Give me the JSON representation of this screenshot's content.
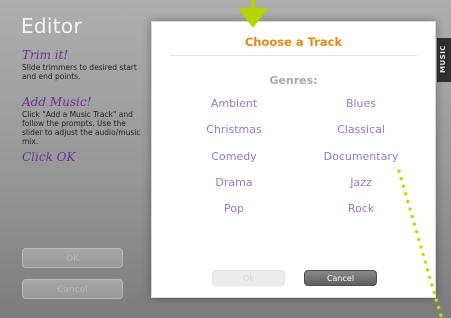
{
  "editor": {
    "title": "Editor",
    "steps": [
      {
        "title": "Trim it!",
        "text": "Slide trimmers to desired start and end points."
      },
      {
        "title": "Add Music!",
        "text": "Click \"Add a Music Track\" and follow the prompts. Use the slider to adjust the audio/music mix."
      },
      {
        "title": "Click OK",
        "text": ""
      }
    ],
    "ok_label": "OK",
    "cancel_label": "Cancel"
  },
  "music_tab": {
    "label": "MUSIC"
  },
  "dialog": {
    "title": "Choose a Track",
    "genres_heading": "Genres:",
    "genres": [
      "Ambient",
      "Blues",
      "Christmas",
      "Classical",
      "Comedy",
      "Documentary",
      "Drama",
      "Jazz",
      "Pop",
      "Rock"
    ],
    "ok_label": "Ok",
    "cancel_label": "Cancel"
  },
  "colors": {
    "accent_title": "#e48a12",
    "genre_link": "#9779c5",
    "step_title": "#6d2f96",
    "pointer": "#b7d400"
  },
  "icons": {
    "pointer": "down-arrow-icon"
  }
}
